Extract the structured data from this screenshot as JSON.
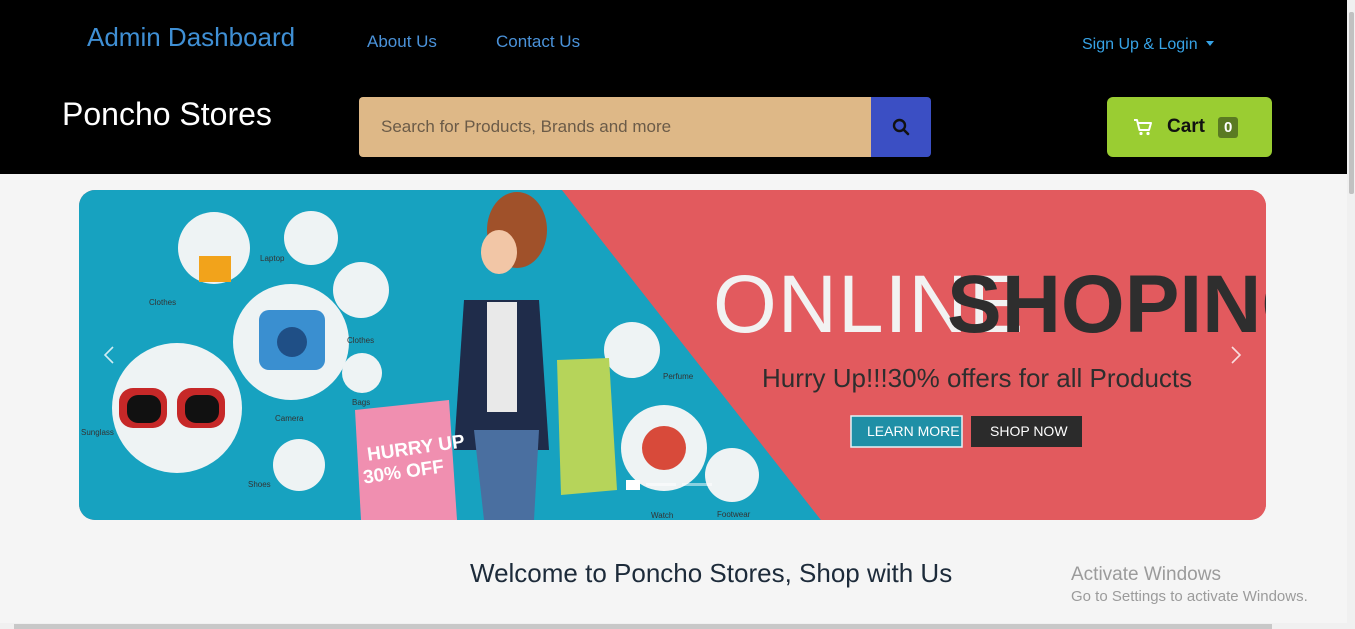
{
  "nav": {
    "admin": "Admin Dashboard",
    "about": "About Us",
    "contact": "Contact Us",
    "signup": "Sign Up & Login"
  },
  "brand": "Poncho Stores",
  "search": {
    "placeholder": "Search for Products, Brands and more",
    "value": ""
  },
  "cart": {
    "label": "Cart",
    "count": "0"
  },
  "banner": {
    "headline_1": "ONLINE",
    "headline_2": "SHOPING",
    "subtitle": "Hurry Up!!!30% offers for all Products",
    "learn_more": "LEARN MORE",
    "shop_now": "SHOP NOW",
    "tag_line_1": "HURRY UP",
    "tag_line_2": "30% OFF",
    "item_labels": [
      "Laptop",
      "Clothes",
      "Clothes",
      "Camera",
      "Bags",
      "Sunglass",
      "Shoes",
      "Perfume",
      "Watch",
      "Footwear"
    ]
  },
  "welcome": "Welcome to Poncho Stores, Shop with Us",
  "watermark": {
    "line1": "Activate Windows",
    "line2": "Go to Settings to activate Windows."
  },
  "colors": {
    "topbar": "#000000",
    "search_bg": "#deb887",
    "search_btn": "#3b4fc4",
    "cart_bg": "#9acd32",
    "banner_teal": "#17a2c0",
    "banner_red": "#e25a5e"
  },
  "icons": {
    "search": "search-icon",
    "cart": "cart-icon",
    "prev": "chevron-left-icon",
    "next": "chevron-right-icon"
  },
  "carousel": {
    "slides": 3,
    "active": 1
  }
}
